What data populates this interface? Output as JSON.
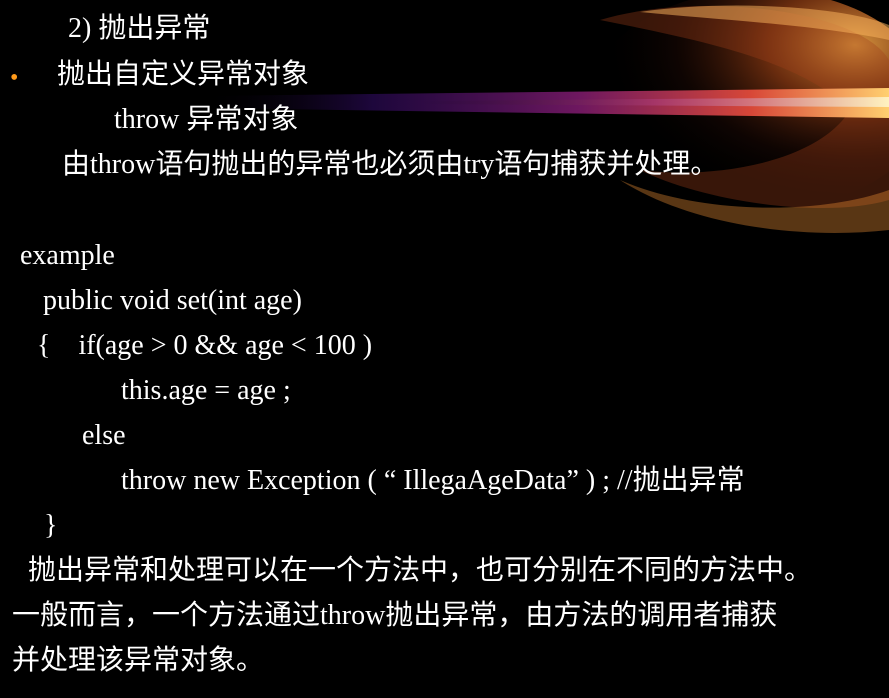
{
  "slide": {
    "section_heading": "2)  抛出异常",
    "bullet_char": "•",
    "bullet_text": "抛出自定义异常对象",
    "syntax_line": "throw   异常对象",
    "note_line": "由throw语句抛出的异常也必须由try语句捕获并处理。",
    "example_label": "example",
    "code_lines": [
      "public void set(int age)",
      "{    if(age > 0 && age < 100 )",
      "this.age = age ;",
      "else",
      "throw new Exception ( “ IllegaAgeData” ) ;  //抛出异常",
      "}"
    ],
    "summary_lines": [
      "抛出异常和处理可以在一个方法中，也可分别在不同的方法中。",
      "一般而言，一个方法通过throw抛出异常，由方法的调用者捕获",
      "并处理该异常对象。"
    ],
    "colors": {
      "background": "#000000",
      "text": "#ffffff",
      "bullet": "#ff9a1a",
      "accent_orange": "#ff8c1a",
      "accent_purple": "#5a1a7a"
    }
  }
}
